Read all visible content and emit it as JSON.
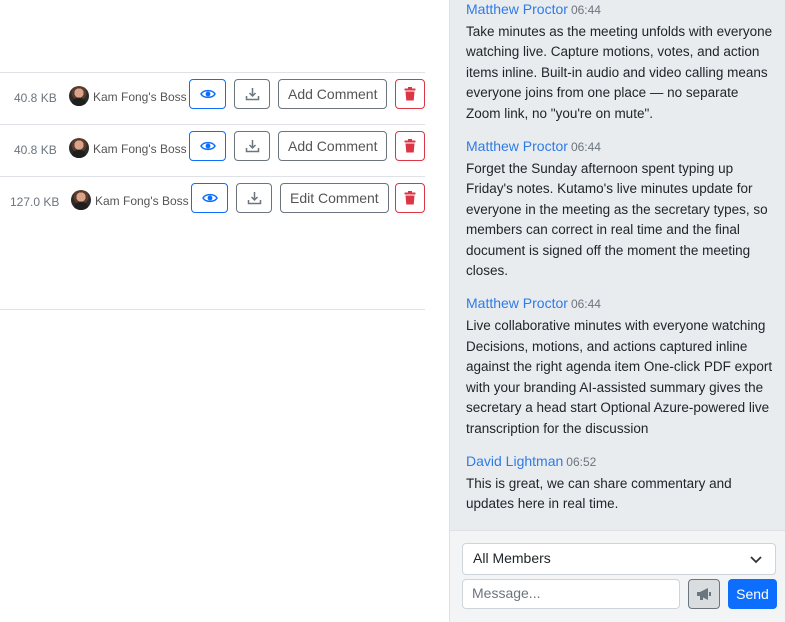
{
  "files": [
    {
      "size": "40.8 KB",
      "owner": "Kam Fong's Boss",
      "comment_label": "Add Comment"
    },
    {
      "size": "40.8 KB",
      "owner": "Kam Fong's Boss",
      "comment_label": "Add Comment"
    },
    {
      "size": "127.0 KB",
      "owner": "Kam Fong's Boss",
      "comment_label": "Edit Comment"
    }
  ],
  "chat": {
    "messages": [
      {
        "name": "Matthew Proctor",
        "time": "06:44",
        "text": "Take minutes as the meeting unfolds with everyone watching live. Capture motions, votes, and action items inline. Built-in audio and video calling means everyone joins from one place — no separate Zoom link, no \"you're on mute\"."
      },
      {
        "name": "Matthew Proctor",
        "time": "06:44",
        "text": "Forget the Sunday afternoon spent typing up Friday's notes. Kutamo's live minutes update for everyone in the meeting as the secretary types, so members can correct in real time and the final document is signed off the moment the meeting closes."
      },
      {
        "name": "Matthew Proctor",
        "time": "06:44",
        "text": "Live collaborative minutes with everyone watching Decisions, motions, and actions captured inline against the right agenda item One-click PDF export with your branding AI-assisted summary gives the secretary a head start Optional Azure-powered live transcription for the discussion"
      },
      {
        "name": "David Lightman",
        "time": "06:52",
        "text": "This is great, we can share commentary and updates here in real time."
      }
    ],
    "recipient": "All Members",
    "message_placeholder": "Message...",
    "send_label": "Send"
  },
  "icons": {
    "view": "eye-icon",
    "download": "download-icon",
    "delete": "trash-icon",
    "dropdown": "chevron-down-icon",
    "announce": "megaphone-icon"
  },
  "colors": {
    "primary": "#0d6efd",
    "danger": "#dc3545",
    "secondary": "#6c757d",
    "author": "#2f7be5",
    "chat_bg": "#e9ecef"
  }
}
